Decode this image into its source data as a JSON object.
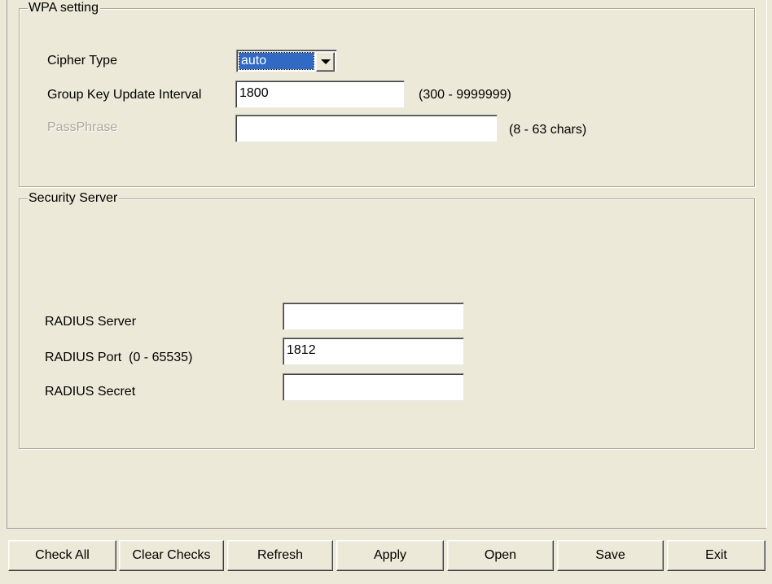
{
  "wpa": {
    "title": "WPA setting",
    "cipher_label": "Cipher Type",
    "cipher_value": "auto",
    "interval_label": "Group Key Update Interval",
    "interval_value": "1800",
    "interval_range": "(300 - 9999999)",
    "passphrase_label": "PassPhrase",
    "passphrase_value": "",
    "passphrase_range": "(8 - 63 chars)"
  },
  "security": {
    "title": "Security Server",
    "radius_server_label": "RADIUS Server",
    "radius_server_value": "",
    "radius_port_label": "RADIUS Port  (0 - 65535)",
    "radius_port_value": "1812",
    "radius_secret_label": "RADIUS Secret",
    "radius_secret_value": ""
  },
  "buttons": {
    "check_all": "Check All",
    "clear_checks": "Clear Checks",
    "refresh": "Refresh",
    "apply": "Apply",
    "open": "Open",
    "save": "Save",
    "exit": "Exit"
  },
  "icons": {
    "dropdown": "chevron-down-icon"
  },
  "colors": {
    "background": "#ece9d8",
    "selection": "#316ac5",
    "disabled_text": "#aca899"
  }
}
